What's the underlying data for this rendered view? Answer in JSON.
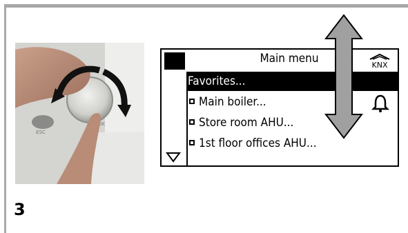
{
  "display": {
    "title": "Main menu",
    "knx_logo": "KNX",
    "items": [
      {
        "label": "Favorites..."
      },
      {
        "label": "Main boiler..."
      },
      {
        "label": "Store room AHU..."
      },
      {
        "label": "1st floor offices AHU..."
      }
    ],
    "icons": [
      "knx-logo-icon",
      "bell-icon",
      "scroll-down-triangle-icon",
      "up-down-arrow-icon"
    ]
  },
  "photo": {
    "labels": [
      "ESC",
      "OK"
    ]
  },
  "figure": {
    "number": "3"
  },
  "colors": {
    "frame": "#a8a8a8",
    "arrow_fill": "#a0a0a0",
    "lcd_text": "#000000"
  }
}
